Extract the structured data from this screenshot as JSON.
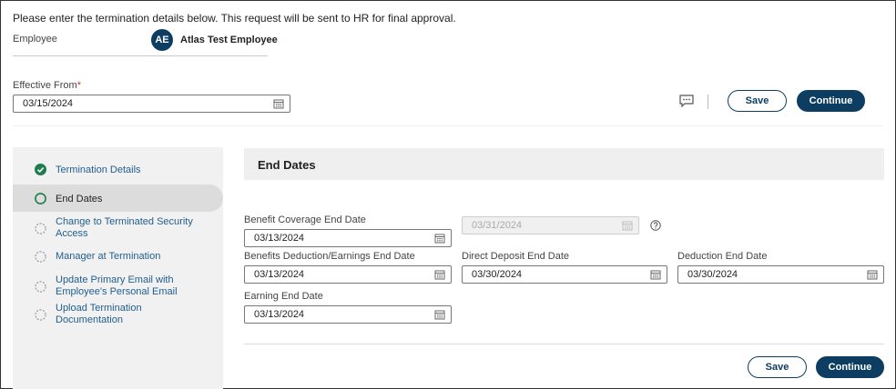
{
  "intro_text": "Please enter the termination details below. This request will be sent to HR for final approval.",
  "employee": {
    "label": "Employee",
    "initials": "AE",
    "name": "Atlas Test Employee"
  },
  "effective_from": {
    "label": "Effective From",
    "required_mark": "*",
    "value": "03/15/2024"
  },
  "header_actions": {
    "comment_icon": "comment-icon",
    "save_label": "Save",
    "continue_label": "Continue"
  },
  "steps": [
    {
      "label": "Termination Details",
      "status": "complete"
    },
    {
      "label": "End Dates",
      "status": "active"
    },
    {
      "label_line1": "Change to Terminated Security",
      "label_line2": "Access",
      "status": "pending"
    },
    {
      "label": "Manager at Termination",
      "status": "pending"
    },
    {
      "label_line1": "Update Primary Email with",
      "label_line2": "Employee's Personal Email",
      "status": "pending"
    },
    {
      "label_line1": "Upload Termination",
      "label_line2": "Documentation",
      "status": "pending"
    }
  ],
  "section": {
    "title": "End Dates"
  },
  "fields": {
    "benefit_coverage": {
      "label": "Benefit Coverage End Date",
      "value": "03/13/2024"
    },
    "benefit_coverage_disabled": {
      "value": "03/31/2024"
    },
    "benefits_deduction": {
      "label": "Benefits Deduction/Earnings End Date",
      "value": "03/13/2024"
    },
    "direct_deposit": {
      "label": "Direct Deposit End Date",
      "value": "03/30/2024"
    },
    "deduction": {
      "label": "Deduction End Date",
      "value": "03/30/2024"
    },
    "earning": {
      "label": "Earning End Date",
      "value": "03/13/2024"
    }
  },
  "footer_actions": {
    "save_label": "Save",
    "continue_label": "Continue"
  },
  "colors": {
    "primary": "#0d3e62",
    "link": "#1f5e8e",
    "complete": "#1e7d4f",
    "required": "#c0392b"
  }
}
